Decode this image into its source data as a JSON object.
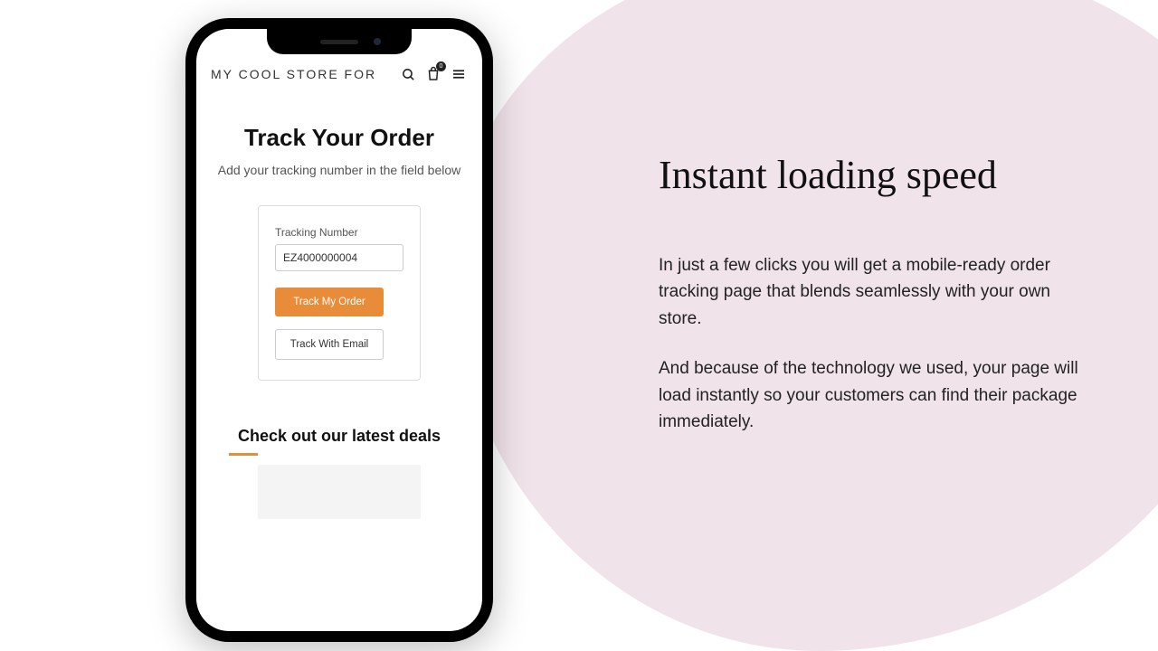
{
  "phone": {
    "header": {
      "store_name": "MY COOL STORE FOR",
      "cart_count": "0"
    },
    "track": {
      "title": "Track Your Order",
      "subtitle": "Add your tracking number in the field below",
      "field_label": "Tracking Number",
      "field_value": "EZ4000000004",
      "primary_btn": "Track My Order",
      "secondary_btn": "Track With Email"
    },
    "deals": {
      "title": "Check out our latest deals"
    }
  },
  "marketing": {
    "headline": "Instant loading speed",
    "p1": "In just a few clicks you will get a mobile-ready order tracking page that blends seamlessly with your own store.",
    "p2": "And because of the technology we used, your  page will load instantly so your customers can find their package immediately."
  }
}
